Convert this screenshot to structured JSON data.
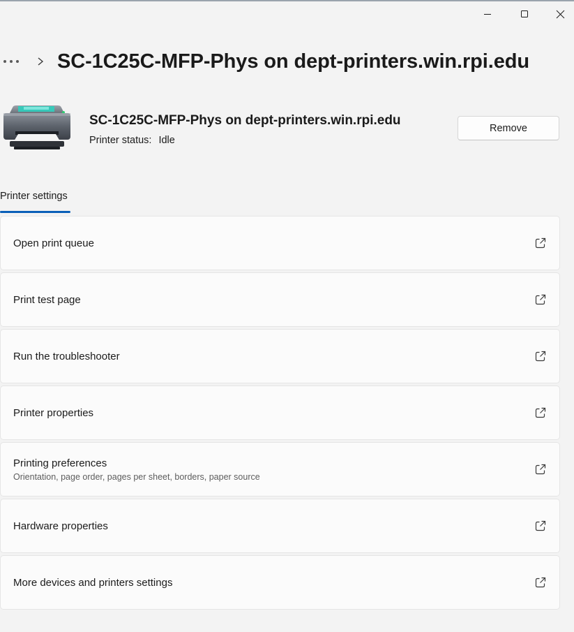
{
  "window": {
    "minimize_icon": "minimize-icon",
    "maximize_icon": "maximize-icon",
    "close_icon": "close-icon"
  },
  "breadcrumb": {
    "more_label": "•••",
    "separator_icon": "chevron-right-icon",
    "title": "SC-1C25C-MFP-Phys on dept-printers.win.rpi.edu"
  },
  "printer": {
    "icon": "printer-icon",
    "name": "SC-1C25C-MFP-Phys on dept-printers.win.rpi.edu",
    "status_label": "Printer status:",
    "status_value": "Idle",
    "remove_label": "Remove"
  },
  "tabs": [
    {
      "label": "Printer settings",
      "selected": true
    }
  ],
  "settings": {
    "link_icon": "open-external-icon",
    "items": [
      {
        "label": "Open print queue",
        "subtitle": ""
      },
      {
        "label": "Print test page",
        "subtitle": ""
      },
      {
        "label": "Run the troubleshooter",
        "subtitle": ""
      },
      {
        "label": "Printer properties",
        "subtitle": ""
      },
      {
        "label": "Printing preferences",
        "subtitle": "Orientation, page order, pages per sheet, borders, paper source"
      },
      {
        "label": "Hardware properties",
        "subtitle": ""
      },
      {
        "label": "More devices and printers settings",
        "subtitle": ""
      }
    ]
  },
  "colors": {
    "accent": "#0a5fb8",
    "background": "#f3f3f3",
    "card": "#fbfbfb",
    "printer_led": "#2ecc71"
  }
}
